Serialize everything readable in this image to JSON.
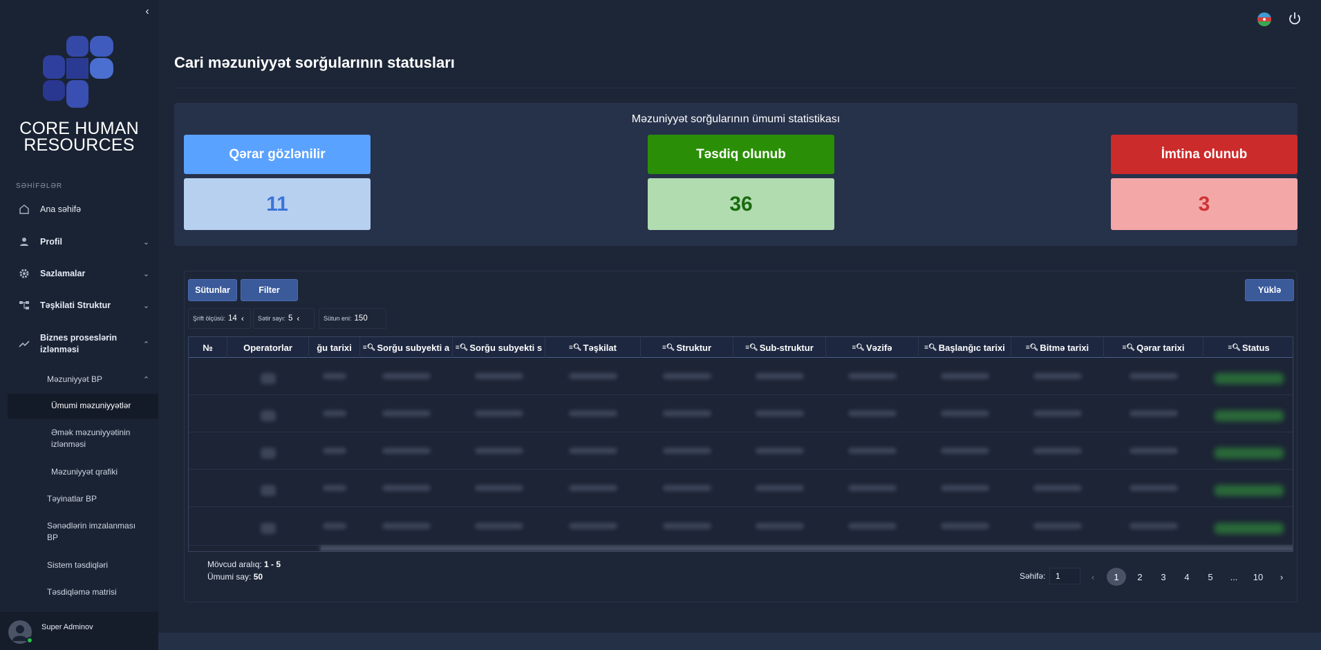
{
  "sidebar": {
    "brand": "CORE HUMAN RESOURCES",
    "section_title": "SƏHİFƏLƏR",
    "items": [
      {
        "label": "Ana səhifə",
        "icon": "home-icon"
      },
      {
        "label": "Profil",
        "icon": "user-icon"
      },
      {
        "label": "Sazlamalar",
        "icon": "gear-icon"
      },
      {
        "label": "Təşkilati Struktur",
        "icon": "org-icon"
      },
      {
        "label": "Biznes proseslərin izlənməsi",
        "icon": "trend-icon"
      }
    ],
    "sub_items": {
      "mezuniyyet_bp": "Məzuniyyət BP",
      "umumi": "Ümumi məzuniyyətlər",
      "emek": "Əmək məzuniyyətinin izlənməsi",
      "qrafik": "Məzuniyyət qrafiki",
      "teyinatlar": "Təyinatlar BP",
      "senedler": "Sənədlərin imzalanması BP",
      "sistem": "Sistem təsdiqləri",
      "matris": "Təsdiqləmə matrisi"
    },
    "user_name": "Super Adminov"
  },
  "header": {
    "page_title": "Cari məzuniyyət sorğularının statusları"
  },
  "stats": {
    "heading": "Məzuniyyət sorğularının ümumi statistikası",
    "pending": {
      "label": "Qərar gözlənilir",
      "value": "11",
      "color": "#5aa2ff"
    },
    "approved": {
      "label": "Təsdiq olunub",
      "value": "36",
      "color": "#2a8f06"
    },
    "rejected": {
      "label": "İmtina olunub",
      "value": "3",
      "color": "#cc2b2b"
    }
  },
  "toolbar": {
    "columns_label": "Sütunlar",
    "filter_label": "Filter",
    "upload_label": "Yüklə",
    "font_size_label": "Şrift ölçüsü:",
    "font_size_value": "14",
    "row_count_label": "Sətir sayı:",
    "row_count_value": "5",
    "col_width_label": "Sütun eni:",
    "col_width_value": "150"
  },
  "table": {
    "columns": [
      "№",
      "Operatorlar",
      "ğu tarixi",
      "Sorğu subyekti a",
      "Sorğu subyekti s",
      "Təşkilat",
      "Struktur",
      "Sub-struktur",
      "Vəzifə",
      "Başlanğıc tarixi",
      "Bitmə tarixi",
      "Qərar tarixi",
      "Status"
    ]
  },
  "footer": {
    "range_label": "Mövcud aralıq:",
    "range_value": "1 - 5",
    "total_label": "Ümumi say:",
    "total_value": "50",
    "page_label": "Səhifə:",
    "page_input": "1",
    "pages": [
      "1",
      "2",
      "3",
      "4",
      "5",
      "...",
      "10"
    ],
    "prev": "‹",
    "next": "›"
  }
}
